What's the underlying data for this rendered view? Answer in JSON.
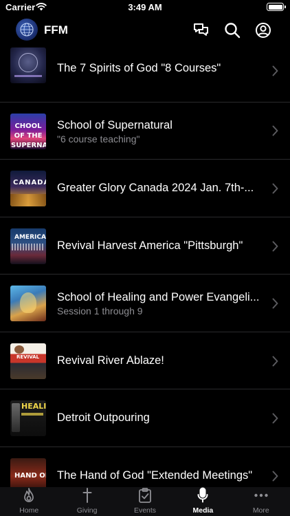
{
  "status": {
    "carrier": "Carrier",
    "time": "3:49 AM"
  },
  "header": {
    "title": "FFM"
  },
  "items": [
    {
      "title": "The 7 Spirits of God \"8 Courses\"",
      "subtitle": "",
      "thumb_text": ""
    },
    {
      "title": "School of Supernatural",
      "subtitle": "\"6 course teaching\"",
      "thumb_text": "CHOOL OF THE SUPERNATURA"
    },
    {
      "title": "Greater Glory Canada 2024 Jan. 7th-...",
      "subtitle": "",
      "thumb_text": "CANADA"
    },
    {
      "title": "Revival Harvest America \"Pittsburgh\"",
      "subtitle": "",
      "thumb_text": "AMERICA"
    },
    {
      "title": "School of Healing and Power Evangeli...",
      "subtitle": "Session 1 through 9",
      "thumb_text": ""
    },
    {
      "title": "Revival River Ablaze!",
      "subtitle": "",
      "thumb_text": "REVIVAL"
    },
    {
      "title": "Detroit Outpouring",
      "subtitle": "",
      "thumb_text": "HEALI"
    },
    {
      "title": "The Hand of God \"Extended Meetings\"",
      "subtitle": "",
      "thumb_text": "HAND OF"
    }
  ],
  "tabs": [
    {
      "label": "Home",
      "icon": "flame-icon"
    },
    {
      "label": "Giving",
      "icon": "cross-icon"
    },
    {
      "label": "Events",
      "icon": "clipboard-check-icon"
    },
    {
      "label": "Media",
      "icon": "microphone-icon",
      "active": true
    },
    {
      "label": "More",
      "icon": "ellipsis-icon"
    }
  ],
  "colors": {
    "background": "#000000",
    "tab_bar": "#101012",
    "inactive": "#8e8e93",
    "active": "#ffffff",
    "separator": "#2b2b2d"
  }
}
